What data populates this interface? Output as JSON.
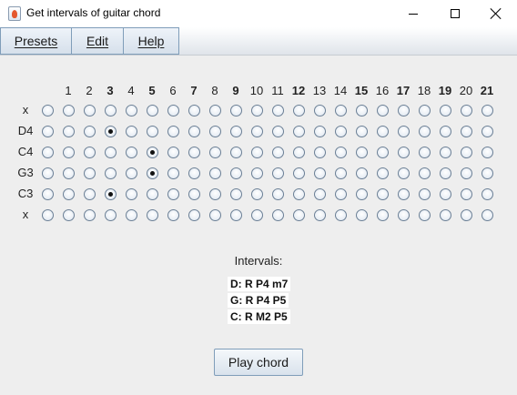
{
  "window": {
    "title": "Get intervals of guitar chord"
  },
  "menu": [
    {
      "label": "Presets"
    },
    {
      "label": "Edit"
    },
    {
      "label": "Help"
    }
  ],
  "frets": [
    {
      "label": "1",
      "bold": false
    },
    {
      "label": "2",
      "bold": false
    },
    {
      "label": "3",
      "bold": true
    },
    {
      "label": "4",
      "bold": false
    },
    {
      "label": "5",
      "bold": true
    },
    {
      "label": "6",
      "bold": false
    },
    {
      "label": "7",
      "bold": true
    },
    {
      "label": "8",
      "bold": false
    },
    {
      "label": "9",
      "bold": true
    },
    {
      "label": "10",
      "bold": false
    },
    {
      "label": "11",
      "bold": false
    },
    {
      "label": "12",
      "bold": true
    },
    {
      "label": "13",
      "bold": false
    },
    {
      "label": "14",
      "bold": false
    },
    {
      "label": "15",
      "bold": true
    },
    {
      "label": "16",
      "bold": false
    },
    {
      "label": "17",
      "bold": true
    },
    {
      "label": "18",
      "bold": false
    },
    {
      "label": "19",
      "bold": true
    },
    {
      "label": "20",
      "bold": false
    },
    {
      "label": "21",
      "bold": true
    }
  ],
  "strings": [
    {
      "label": "x",
      "selected_column": 0
    },
    {
      "label": "D4",
      "selected_column": 3
    },
    {
      "label": "C4",
      "selected_column": 5
    },
    {
      "label": "G3",
      "selected_column": 5
    },
    {
      "label": "C3",
      "selected_column": 3
    },
    {
      "label": "x",
      "selected_column": 0
    }
  ],
  "intervals": {
    "heading": "Intervals:",
    "lines": [
      "D: R P4 m7",
      "G: R P4 P5",
      "C: R M2 P5"
    ]
  },
  "play_button": {
    "label": "Play chord"
  }
}
